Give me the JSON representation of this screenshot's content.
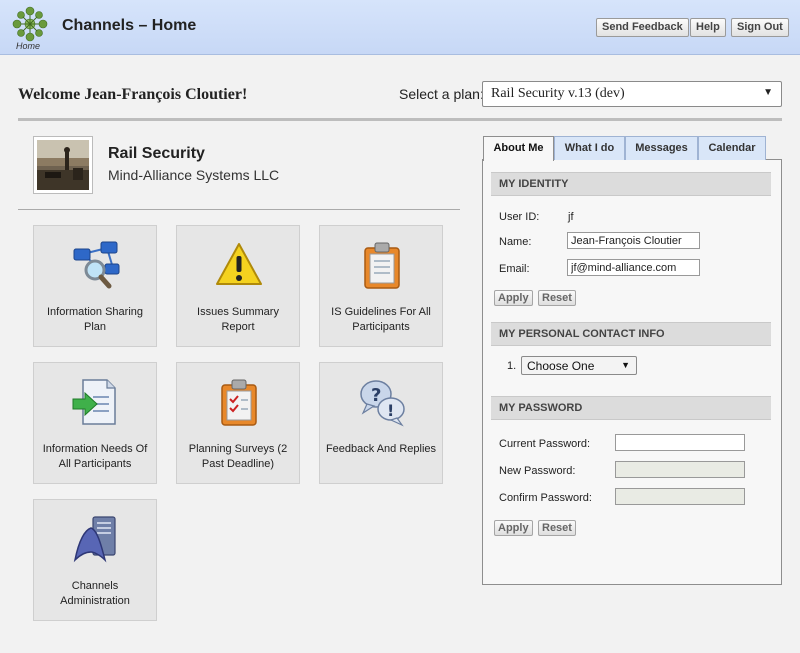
{
  "header": {
    "title": "Channels – Home",
    "logo_caption": "Home",
    "buttons": {
      "feedback": "Send Feedback",
      "help": "Help",
      "signout": "Sign Out"
    }
  },
  "welcome": {
    "greeting": "Welcome Jean-François Cloutier!",
    "plan_label": "Select a plan:",
    "plan_selected": "Rail Security v.13 (dev)"
  },
  "project": {
    "name": "Rail Security",
    "organization": "Mind-Alliance Systems LLC"
  },
  "tiles": [
    {
      "label": "Information Sharing Plan",
      "icon": "network-magnifier-icon"
    },
    {
      "label": "Issues Summary Report",
      "icon": "warning-icon"
    },
    {
      "label": "IS Guidelines For All Participants",
      "icon": "clipboard-icon"
    },
    {
      "label": "Information Needs Of All Participants",
      "icon": "document-arrow-icon"
    },
    {
      "label": "Planning Surveys (2 Past Deadline)",
      "icon": "survey-clipboard-icon"
    },
    {
      "label": "Feedback And Replies",
      "icon": "speech-bubbles-icon"
    },
    {
      "label": "Channels Administration",
      "icon": "admin-icon"
    }
  ],
  "panel": {
    "tabs": [
      "About Me",
      "What I do",
      "Messages",
      "Calendar"
    ],
    "identity": {
      "heading": "MY IDENTITY",
      "userid_label": "User ID:",
      "userid_value": "jf",
      "name_label": "Name:",
      "name_value": "Jean-François Cloutier",
      "email_label": "Email:",
      "email_value": "jf@mind-alliance.com",
      "apply": "Apply",
      "reset": "Reset"
    },
    "contact": {
      "heading": "MY PERSONAL CONTACT INFO",
      "index": "1.",
      "choose": "Choose One"
    },
    "password": {
      "heading": "MY PASSWORD",
      "current_label": "Current Password:",
      "new_label": "New Password:",
      "confirm_label": "Confirm Password:",
      "apply": "Apply",
      "reset": "Reset"
    }
  }
}
